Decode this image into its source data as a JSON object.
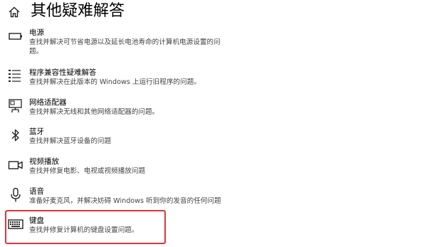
{
  "page": {
    "title": "其他疑难解答"
  },
  "colors": {
    "highlight": "#e0343b"
  },
  "items": [
    {
      "icon": "battery-icon",
      "title": "电源",
      "desc1": "查找并解决可节省电源以及延长电池寿命的计算机电源设置的问",
      "desc2": "题。"
    },
    {
      "icon": "list-icon",
      "title": "程序兼容性疑难解答",
      "desc1": "查找并解决在此版本的 Windows 上运行旧程序的问题。"
    },
    {
      "icon": "monitor-network-icon",
      "title": "网络适配器",
      "desc1": "查找并解决无线和其他网络适配器的问题。"
    },
    {
      "icon": "bluetooth-icon",
      "title": "蓝牙",
      "desc1": "查找并解决蓝牙设备的问题"
    },
    {
      "icon": "video-camera-icon",
      "title": "视频播放",
      "desc1": "查找并修复电影、电视或视频播放问题"
    },
    {
      "icon": "microphone-icon",
      "title": "语音",
      "desc1": "准备好麦克风，并解决妨碍 Windows 听到你的发音的任何问题"
    },
    {
      "icon": "keyboard-icon",
      "title": "键盘",
      "desc1": "查找并修复计算机的键盘设置问题。"
    }
  ]
}
